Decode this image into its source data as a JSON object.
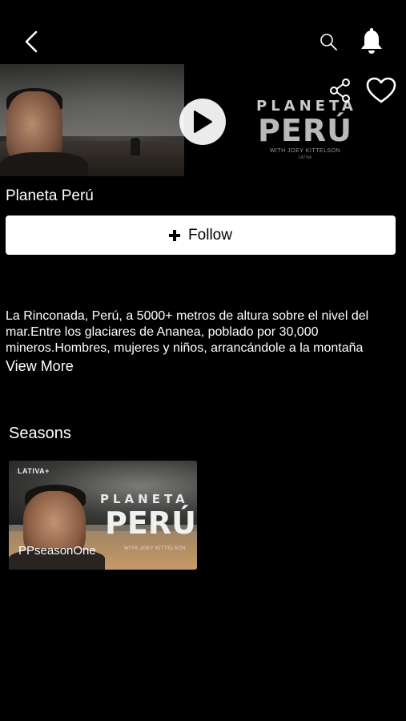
{
  "header": {
    "back_icon": "chevron-left-icon",
    "search_icon": "search-icon",
    "notifications_icon": "bell-icon"
  },
  "hero": {
    "poster_title_line1": "PLANETA",
    "poster_title_line2": "PERÚ",
    "poster_subtitle": "WITH JOEY KITTELSON",
    "poster_brand": "LATIVA",
    "play_icon": "play-icon",
    "share_icon": "share-icon",
    "favorite_icon": "heart-icon"
  },
  "show": {
    "title": "Planeta Perú",
    "follow_label": "Follow",
    "description": "La Rinconada, Perú, a 5000+ metros de altura sobre el nivel del mar.Entre los glaciares de Ananea, poblado por 30,000 mineros.Hombres, mujeres y niños, arrancándole a la montaña",
    "view_more_label": "View More"
  },
  "seasons": {
    "heading": "Seasons",
    "items": [
      {
        "label": "PPseasonOne",
        "brand": "LATIVA+",
        "poster_title_line1": "PLANETA",
        "poster_title_line2": "PERÚ",
        "poster_subtitle": "WITH JOEY KITTELSON"
      }
    ]
  },
  "colors": {
    "background": "#000000",
    "text": "#ffffff",
    "follow_button_bg": "#ffffff",
    "follow_button_text": "#000000"
  }
}
